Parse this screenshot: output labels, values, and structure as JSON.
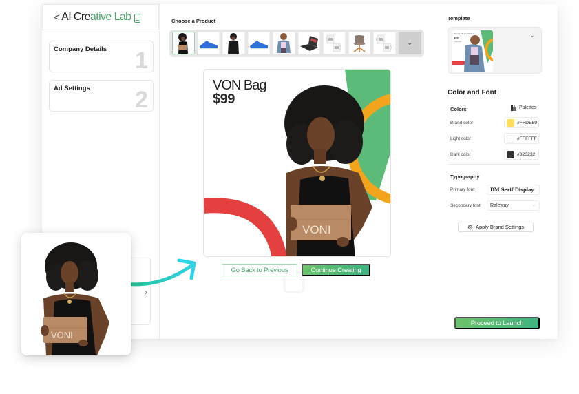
{
  "app": {
    "back_glyph": "<",
    "title_part1": "AI Cre",
    "title_part2": "ative Lab",
    "device_icon": "mobile-device-icon"
  },
  "sidebar": {
    "steps": [
      {
        "label": "Company Details",
        "number": "1"
      },
      {
        "label": "Ad Settings",
        "number": "2"
      }
    ],
    "collapsed_panel_chevron": "›"
  },
  "product_picker": {
    "label": "Choose a Product",
    "items": [
      {
        "name": "woman-with-brown-bag",
        "selected": true
      },
      {
        "name": "blue-sneaker",
        "selected": false
      },
      {
        "name": "woman-in-black-jacket",
        "selected": false
      },
      {
        "name": "blue-sneaker-2",
        "selected": false
      },
      {
        "name": "woman-in-denim-jacket",
        "selected": false
      },
      {
        "name": "laptop",
        "selected": false
      },
      {
        "name": "white-mugs",
        "selected": false
      },
      {
        "name": "swivel-chair",
        "selected": false
      },
      {
        "name": "white-mugs-2",
        "selected": false
      }
    ],
    "more_glyph": "⌄"
  },
  "ad_preview": {
    "product_name": "VON Bag",
    "price": "$99",
    "bag_logo": "VONI"
  },
  "actions": {
    "back_label": "Go Back to Previous",
    "continue_label": "Continue Creating",
    "launch_label": "Proceed to Launch"
  },
  "template": {
    "label": "Template",
    "thumb_title": "Trendy Flower Jacket",
    "thumb_price": "$99",
    "thumb_brand": "Lyfestyle",
    "chevron": "⌄"
  },
  "color_and_font": {
    "heading": "Color and Font",
    "colors_label": "Colors",
    "palettes_label": "Palettes",
    "colors": [
      {
        "label": "Brand color",
        "hex": "#FFDE59"
      },
      {
        "label": "Light color",
        "hex": "#FFFFFF"
      },
      {
        "label": "Dark color",
        "hex": "#323232"
      }
    ],
    "typography_label": "Typography",
    "fonts": [
      {
        "label": "Primary font",
        "value": "DM Serif Display"
      },
      {
        "label": "Secondary font",
        "value": "Raleway"
      }
    ],
    "apply_label": "Apply Brand Settings"
  },
  "theme": {
    "accent_green": "#49A66B",
    "gradient_start": "#6DC26A",
    "gradient_end": "#3FB37F",
    "arrow_cyan": "#2FD3E6",
    "ad_green": "#5DBB7A",
    "ad_orange": "#F2A51C",
    "ad_red": "#E3403F",
    "bag_brown": "#B98A66"
  }
}
